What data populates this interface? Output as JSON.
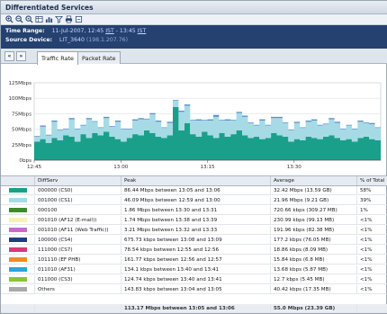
{
  "window": {
    "title": "Differentiated Services"
  },
  "toolbar": {
    "icons": [
      "zoom-in-icon",
      "zoom-out-icon",
      "zoom-reset-icon",
      "table-icon",
      "chart-icon",
      "filter-icon",
      "print-icon",
      "export-icon"
    ]
  },
  "info": {
    "time_label": "Time Range:",
    "time_date": "11-Jul-2007, 12:45 ",
    "time_tz1": "IST",
    "time_sep": " - 13:45 ",
    "time_tz2": "IST",
    "source_label": "Source Device:",
    "source_name": "LIT_3640 ",
    "source_ip": "(198.1.207.76)"
  },
  "nav": {
    "back": "«",
    "forward": "»"
  },
  "tabs": [
    {
      "label": "Traffic Rate",
      "active": true
    },
    {
      "label": "Packet Rate",
      "active": false
    }
  ],
  "chart_data": {
    "type": "area",
    "y_ticks": [
      "0bps",
      "25Mbps",
      "50Mbps",
      "75Mbps",
      "100Mbps",
      "125Mbps"
    ],
    "ylim": [
      0,
      125
    ],
    "y_unit": "Mbps",
    "x_ticks": [
      "12:45",
      "13:00",
      "13:15",
      "13:30"
    ],
    "x_range_minutes": [
      0,
      60
    ],
    "grid": true,
    "series": [
      {
        "name": "000000 (CS0)",
        "color": "#1aa08a",
        "values": [
          30,
          34,
          28,
          36,
          32,
          40,
          38,
          30,
          42,
          36,
          44,
          40,
          46,
          38,
          34,
          30,
          36,
          42,
          40,
          48,
          44,
          38,
          36,
          40,
          86,
          48,
          60,
          42,
          38,
          46,
          40,
          36,
          44,
          38,
          42,
          48,
          40,
          36,
          38,
          34,
          36,
          44,
          40,
          38,
          30,
          34,
          32,
          38,
          36,
          34,
          38,
          40,
          36,
          32,
          34,
          30,
          36,
          38,
          34,
          32
        ]
      },
      {
        "name": "001000 (CS1)",
        "color": "#a6dbe6",
        "values": [
          8,
          20,
          12,
          26,
          16,
          10,
          28,
          20,
          14,
          30,
          18,
          12,
          22,
          16,
          28,
          20,
          14,
          22,
          26,
          18,
          30,
          24,
          16,
          20,
          10,
          30,
          28,
          22,
          26,
          18,
          24,
          34,
          20,
          26,
          22,
          28,
          30,
          24,
          18,
          30,
          20,
          24,
          28,
          22,
          18,
          26,
          20,
          24,
          28,
          22,
          20,
          26,
          24,
          18,
          22,
          20,
          26,
          22,
          24,
          20
        ]
      },
      {
        "name": "Others",
        "color": "#5f8fc9",
        "values": [
          1,
          2,
          1,
          2,
          1,
          1,
          2,
          1,
          1,
          2,
          1,
          1,
          2,
          1,
          2,
          1,
          1,
          2,
          2,
          1,
          2,
          2,
          1,
          2,
          1,
          2,
          2,
          1,
          2,
          1,
          2,
          3,
          1,
          2,
          1,
          2,
          2,
          1,
          1,
          2,
          1,
          2,
          2,
          1,
          1,
          2,
          1,
          2,
          2,
          1,
          1,
          2,
          2,
          1,
          1,
          1,
          2,
          1,
          2,
          1
        ]
      }
    ]
  },
  "table": {
    "headers": {
      "diffserv": "DiffServ",
      "peak": "Peak",
      "average": "Average",
      "pct": "% of Total"
    },
    "rows": [
      {
        "name": "000000 (CS0)",
        "color": "#1aa08a",
        "peak": "86.44 Mbps between 13:05 and 13:06",
        "average": "32.42 Mbps (13.59 GB)",
        "pct": "58%"
      },
      {
        "name": "001000 (CS1)",
        "color": "#a6dbe6",
        "peak": "46.09 Mbps between 12:59 and 13:00",
        "average": "21.96 Mbps (9.21 GB)",
        "pct": "39%"
      },
      {
        "name": "000100",
        "color": "#3e8b2a",
        "peak": "1.86 Mbps between 13:30 and 13:31",
        "average": "720.66 kbps (309.27 MB)",
        "pct": "1%"
      },
      {
        "name": "001010 (AF12 (E-mail))",
        "color": "#f4f2b8",
        "peak": "1.74 Mbps between 13:38 and 13:39",
        "average": "230.99 kbps (99.13 MB)",
        "pct": "<1%"
      },
      {
        "name": "001010 (AF11 (Web Traffic))",
        "color": "#c96ad0",
        "peak": "3.21 Mbps between 13:32 and 13:33",
        "average": "191.96 kbps (82.38 MB)",
        "pct": "<1%"
      },
      {
        "name": "100000 (CS4)",
        "color": "#1c3f82",
        "peak": "675.73 kbps between 13:08 and 13:09",
        "average": "177.2 kbps (76.05 MB)",
        "pct": "<1%"
      },
      {
        "name": "111000 (CS7)",
        "color": "#d63a7c",
        "peak": "78.54 kbps between 12:55 and 12:56",
        "average": "18.86 kbps (8.09 MB)",
        "pct": "<1%"
      },
      {
        "name": "101110 (EF PHB)",
        "color": "#f08c24",
        "peak": "161.77 kbps between 12:56 and 12:57",
        "average": "15.84 kbps (6.8 MB)",
        "pct": "<1%"
      },
      {
        "name": "011010 (AF31)",
        "color": "#2aa6d9",
        "peak": "134.1 kbps between 13:40 and 13:41",
        "average": "13.68 kbps (5.87 MB)",
        "pct": "<1%"
      },
      {
        "name": "011000 (CS3)",
        "color": "#8ac43a",
        "peak": "124.74 kbps between 13:40 and 13:41",
        "average": "12.7 kbps (5.45 MB)",
        "pct": "<1%"
      },
      {
        "name": "Others",
        "color": "#a9a9a9",
        "peak": "143.83 kbps between 13:04 and 13:05",
        "average": "40.42 kbps (17.35 MB)",
        "pct": "<1%"
      }
    ],
    "total": {
      "peak": "113.17 Mbps between 13:05 and 13:06",
      "average": "55.0 Mbps (23.39 GB)"
    }
  }
}
